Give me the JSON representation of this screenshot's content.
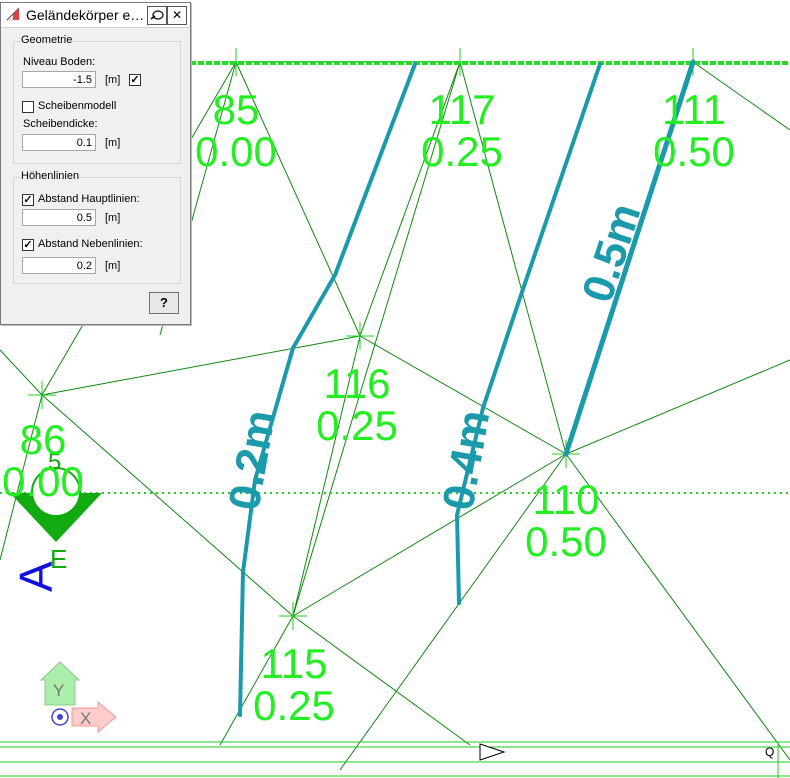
{
  "dialog": {
    "title": "Geländekörper e…",
    "group_geometry": "Geometrie",
    "niveau_label": "Niveau Boden:",
    "niveau_value": "-1.5",
    "niveau_unit": "[m]",
    "niveau_check": "✓",
    "scheiben_label": "Scheibenmodell",
    "scheibendicke_label": "Scheibendicke:",
    "scheibendicke_value": "0.1",
    "scheibendicke_unit": "[m]",
    "group_contours": "Höhenlinien",
    "haupt_label": "Abstand Hauptlinien:",
    "haupt_check": "✓",
    "haupt_value": "0.5",
    "haupt_unit": "[m]",
    "neben_label": "Abstand Nebenlinien:",
    "neben_check": "✓",
    "neben_value": "0.2",
    "neben_unit": "[m]",
    "help_label": "?",
    "pin_icon": "pin-icon",
    "close_label": "✕"
  },
  "nodes": [
    {
      "id": "85",
      "elev": "0.00"
    },
    {
      "id": "117",
      "elev": "0.25"
    },
    {
      "id": "111",
      "elev": "0.50"
    },
    {
      "id": "116",
      "elev": "0.25"
    },
    {
      "id": "86",
      "elev": "0.00"
    },
    {
      "id": "110",
      "elev": "0.50"
    },
    {
      "id": "115",
      "elev": "0.25"
    }
  ],
  "contour_labels": [
    "0.2m",
    "0.4m",
    "0.5m"
  ],
  "support": {
    "number": "5",
    "letter": "A",
    "sub": "E"
  },
  "axes": {
    "y": "Y",
    "x": "X"
  },
  "corner_label": "Q",
  "colors": {
    "node_label": "#22ee22",
    "contour": "#1a9aaa",
    "mesh_line": "#118811",
    "support": "#11aa11",
    "axis_blue": "#1111dd"
  }
}
